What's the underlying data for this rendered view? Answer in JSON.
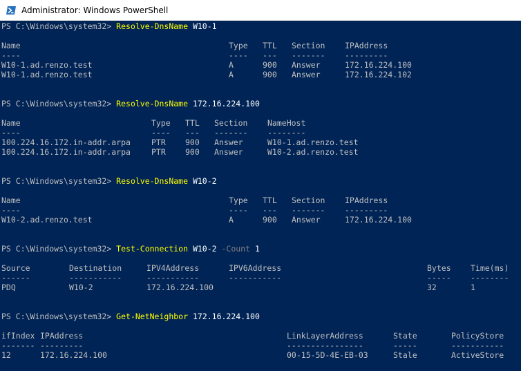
{
  "window": {
    "title": "Administrator: Windows PowerShell",
    "icon": "powershell-icon",
    "colors": {
      "background": "#012456",
      "text": "#c0c0c0",
      "command": "#ffff00",
      "parameter": "#808080",
      "argument": "#ffffff"
    }
  },
  "blocks": [
    {
      "prompt": "PS C:\\Windows\\system32> ",
      "command": "Resolve-DnsName",
      "args": " W10-1",
      "columns": [
        "Name",
        "Type",
        "TTL",
        "Section",
        "IPAddress"
      ],
      "dashes": [
        "----",
        "----",
        "---",
        "-------",
        "---------"
      ],
      "rows": [
        [
          "W10-1.ad.renzo.test",
          "A",
          "900",
          "Answer",
          "172.16.224.100"
        ],
        [
          "W10-1.ad.renzo.test",
          "A",
          "900",
          "Answer",
          "172.16.224.102"
        ]
      ]
    },
    {
      "prompt": "PS C:\\Windows\\system32> ",
      "command": "Resolve-DnsName",
      "args": " 172.16.224.100",
      "columns": [
        "Name",
        "Type",
        "TTL",
        "Section",
        "NameHost"
      ],
      "dashes": [
        "----",
        "----",
        "---",
        "-------",
        "--------"
      ],
      "rows": [
        [
          "100.224.16.172.in-addr.arpa",
          "PTR",
          "900",
          "Answer",
          "W10-1.ad.renzo.test"
        ],
        [
          "100.224.16.172.in-addr.arpa",
          "PTR",
          "900",
          "Answer",
          "W10-2.ad.renzo.test"
        ]
      ]
    },
    {
      "prompt": "PS C:\\Windows\\system32> ",
      "command": "Resolve-DnsName",
      "args": " W10-2",
      "columns": [
        "Name",
        "Type",
        "TTL",
        "Section",
        "IPAddress"
      ],
      "dashes": [
        "----",
        "----",
        "---",
        "-------",
        "---------"
      ],
      "rows": [
        [
          "W10-2.ad.renzo.test",
          "A",
          "900",
          "Answer",
          "172.16.224.100"
        ]
      ]
    },
    {
      "prompt": "PS C:\\Windows\\system32> ",
      "command": "Test-Connection",
      "args": " W10-2",
      "param": " -Count",
      "param_value": " 1",
      "columns": [
        "Source",
        "Destination",
        "IPV4Address",
        "IPV6Address",
        "Bytes",
        "Time(ms)"
      ],
      "dashes": [
        "------",
        "-----------",
        "-----------",
        "-----------",
        "-----",
        "--------"
      ],
      "rows": [
        [
          "PDQ",
          "W10-2",
          "172.16.224.100",
          "",
          "32",
          "1"
        ]
      ]
    },
    {
      "prompt": "PS C:\\Windows\\system32> ",
      "command": "Get-NetNeighbor",
      "args": " 172.16.224.100",
      "columns": [
        "ifIndex",
        "IPAddress",
        "LinkLayerAddress",
        "State",
        "PolicyStore"
      ],
      "dashes": [
        "-------",
        "---------",
        "----------------",
        "-----",
        "-----------"
      ],
      "rows": [
        [
          "12",
          "172.16.224.100",
          "00-15-5D-4E-EB-03",
          "Stale",
          "ActiveStore"
        ]
      ]
    }
  ]
}
